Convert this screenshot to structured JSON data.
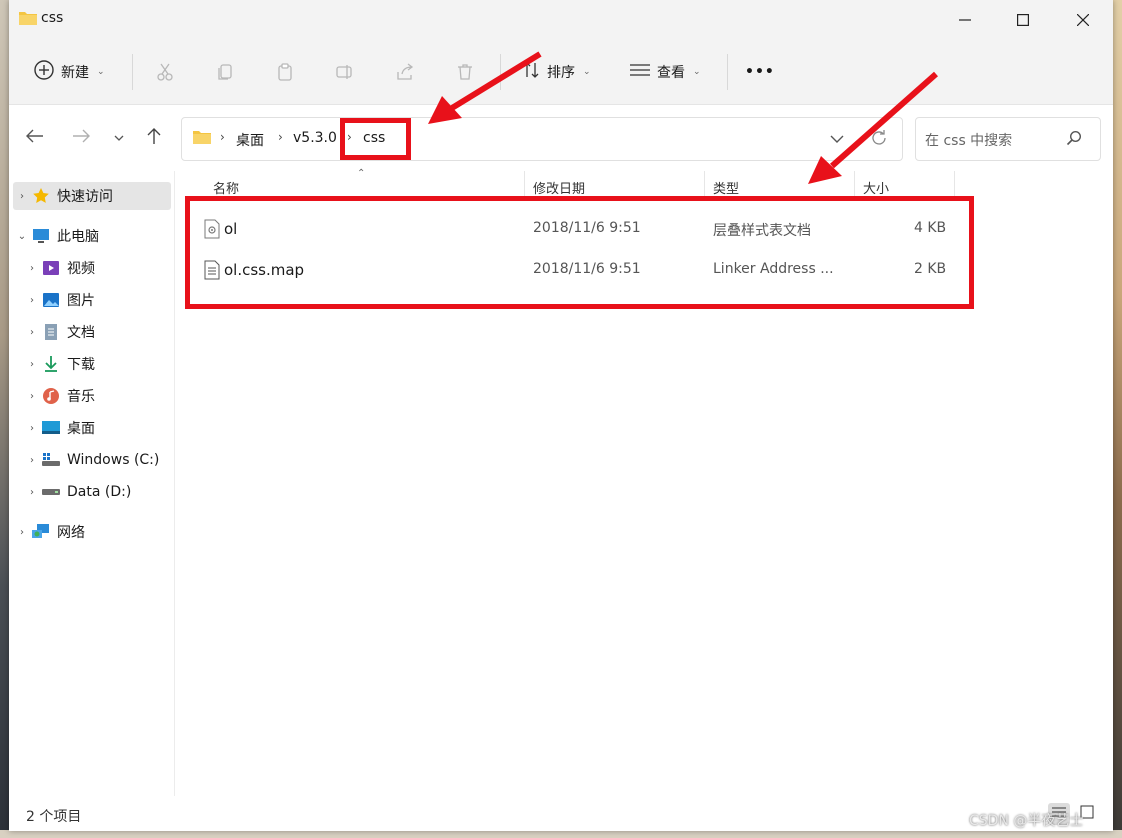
{
  "window": {
    "title": "css"
  },
  "toolbar": {
    "new_label": "新建",
    "sort_label": "排序",
    "view_label": "查看",
    "more_label": "•••"
  },
  "breadcrumb": {
    "items": [
      "桌面",
      "v5.3.0",
      "css"
    ]
  },
  "search": {
    "placeholder": "在 css 中搜索"
  },
  "sidebar": {
    "items": [
      {
        "label": "快速访问",
        "icon": "star-icon"
      },
      {
        "label": "此电脑",
        "icon": "computer-icon"
      },
      {
        "label": "视频",
        "icon": "video-icon"
      },
      {
        "label": "图片",
        "icon": "pictures-icon"
      },
      {
        "label": "文档",
        "icon": "documents-icon"
      },
      {
        "label": "下载",
        "icon": "download-icon"
      },
      {
        "label": "音乐",
        "icon": "music-icon"
      },
      {
        "label": "桌面",
        "icon": "desktop-icon"
      },
      {
        "label": "Windows (C:)",
        "icon": "drive-c-icon"
      },
      {
        "label": "Data (D:)",
        "icon": "drive-d-icon"
      },
      {
        "label": "网络",
        "icon": "network-icon"
      }
    ]
  },
  "table": {
    "columns": [
      "名称",
      "修改日期",
      "类型",
      "大小"
    ],
    "rows": [
      {
        "name": "ol",
        "date": "2018/11/6 9:51",
        "type": "层叠样式表文档",
        "size": "4 KB",
        "icon": "css-file-icon"
      },
      {
        "name": "ol.css.map",
        "date": "2018/11/6 9:51",
        "type": "Linker Address ...",
        "size": "2 KB",
        "icon": "text-file-icon"
      }
    ]
  },
  "status": {
    "item_count": "2 个项目"
  },
  "watermark": "CSDN @半夜艺士",
  "colors": {
    "annotation": "#e8111a",
    "folder": "#f4c542"
  }
}
